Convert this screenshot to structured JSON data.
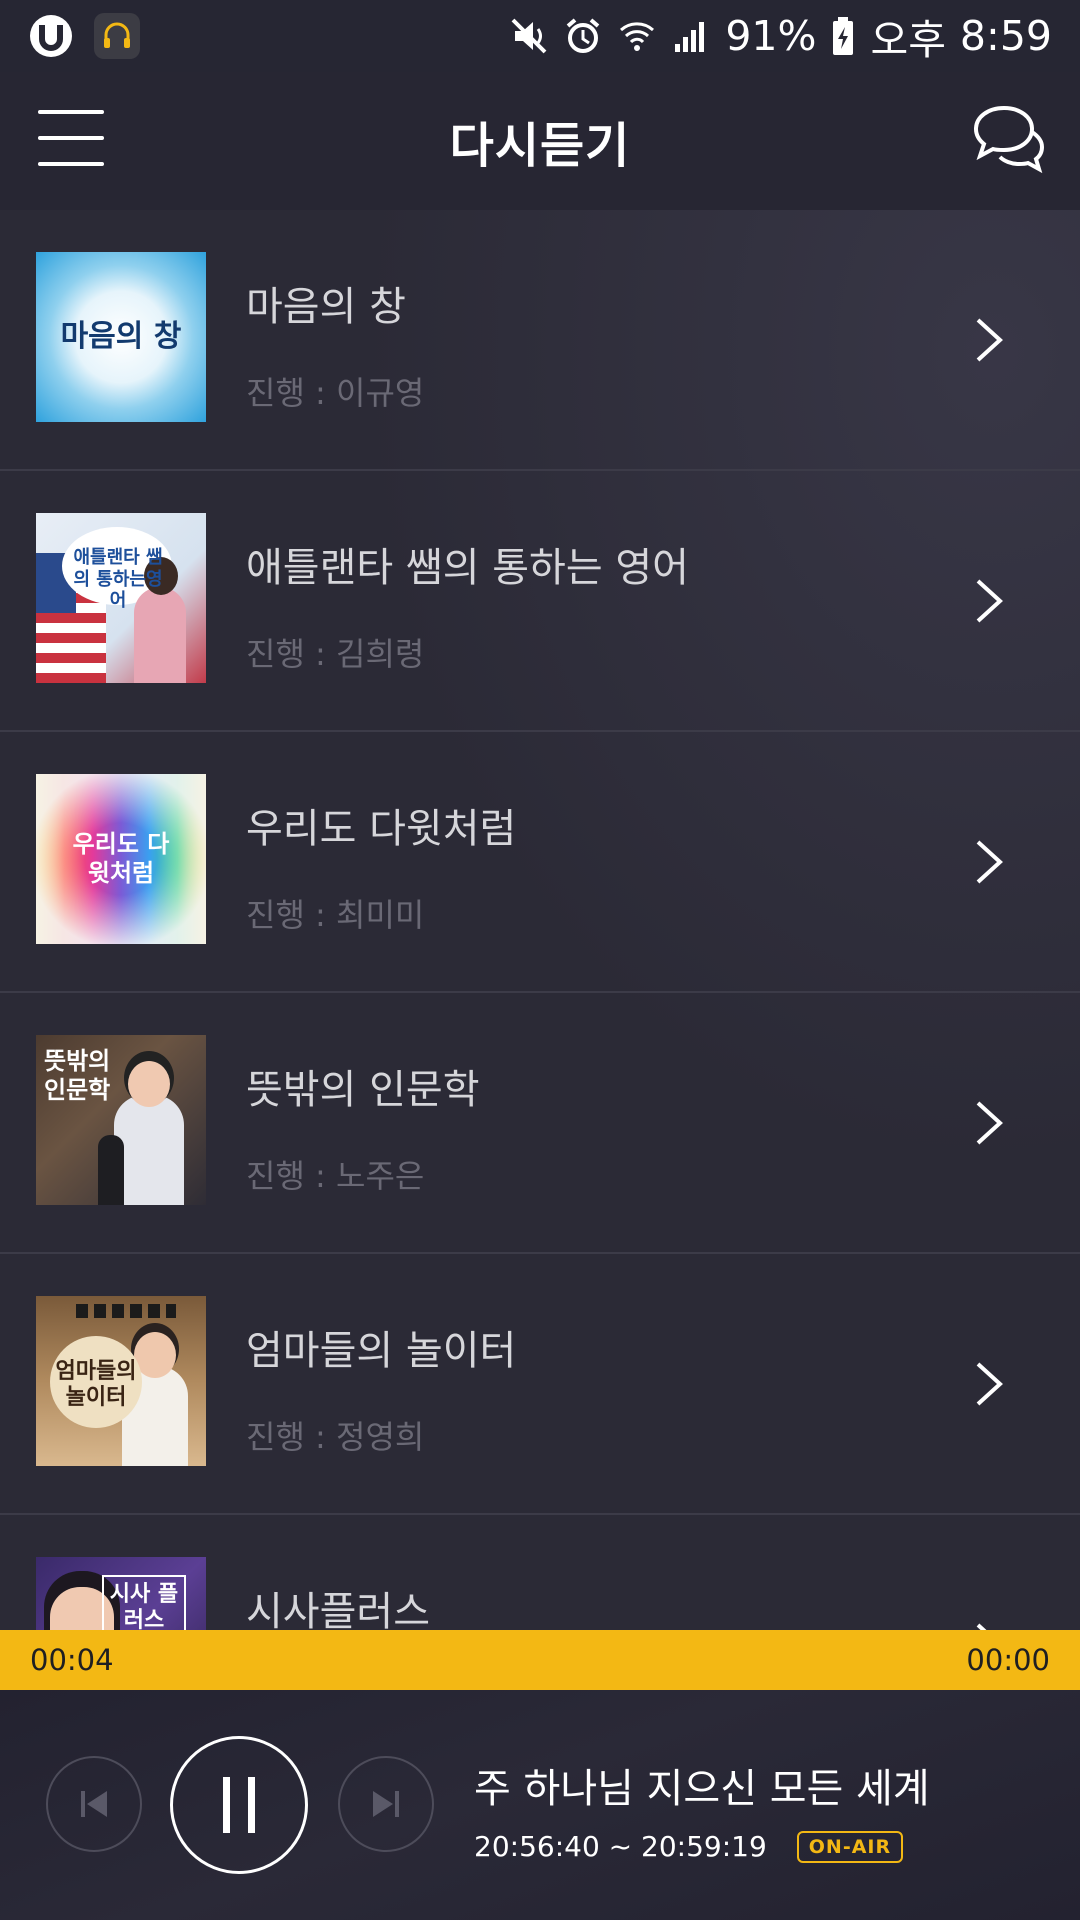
{
  "status_bar": {
    "battery": "91%",
    "ampm": "오후",
    "time": "8:59"
  },
  "header": {
    "title": "다시듣기"
  },
  "list": {
    "items": [
      {
        "title": "마음의 창",
        "host": "진행 : 이규영",
        "thumb_text": "마음의 창"
      },
      {
        "title": "애틀랜타 쌤의 통하는 영어",
        "host": "진행 : 김희령",
        "thumb_text": "애틀랜타 쌤의 통하는영어"
      },
      {
        "title": "우리도 다윗처럼",
        "host": "진행 : 최미미",
        "thumb_text": "우리도 다윗처럼"
      },
      {
        "title": "뜻밖의 인문학",
        "host": "진행 : 노주은",
        "thumb_text": "뜻밖의 인문학"
      },
      {
        "title": "엄마들의 놀이터",
        "host": "진행 : 정영희",
        "thumb_text": "엄마들의 놀이터"
      },
      {
        "title": "시사플러스",
        "host": "",
        "thumb_text": "시사 플러스"
      }
    ]
  },
  "progress": {
    "elapsed": "00:04",
    "remaining": "00:00"
  },
  "player": {
    "title": "주 하나님 지으신 모든 세계",
    "time_range": "20:56:40 ~ 20:59:19",
    "badge": "ON-AIR"
  },
  "colors": {
    "accent": "#f3b814",
    "background": "#2b2a36",
    "header": "#272633"
  }
}
